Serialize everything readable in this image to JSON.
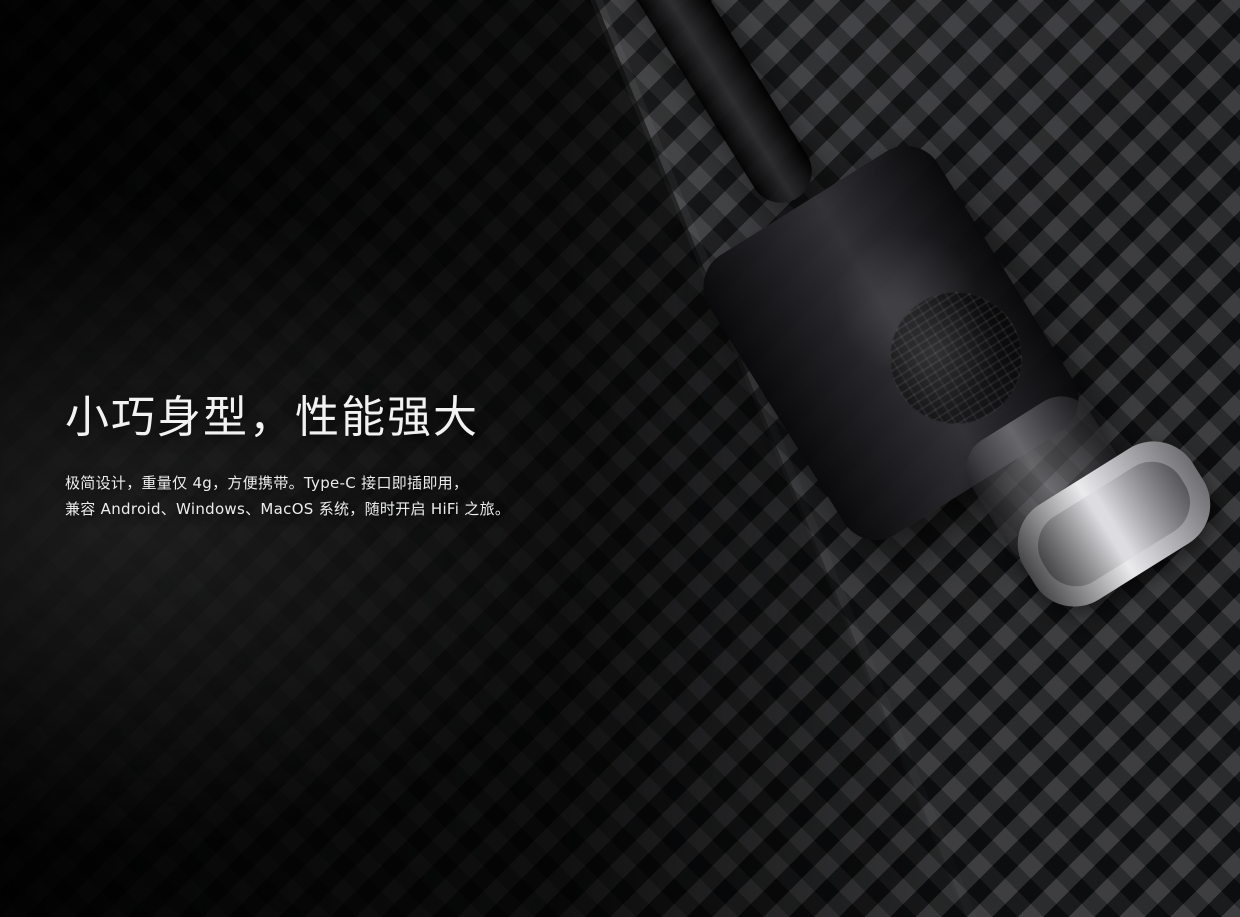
{
  "hero": {
    "headline": "小巧身型，性能强大",
    "description_lines": [
      "极简设计，重量仅 4g，方便携带。Type-C 接口即插即用，",
      "兼容 Android、Windows、MacOS 系统，随时开启 HiFi 之旅。"
    ]
  }
}
